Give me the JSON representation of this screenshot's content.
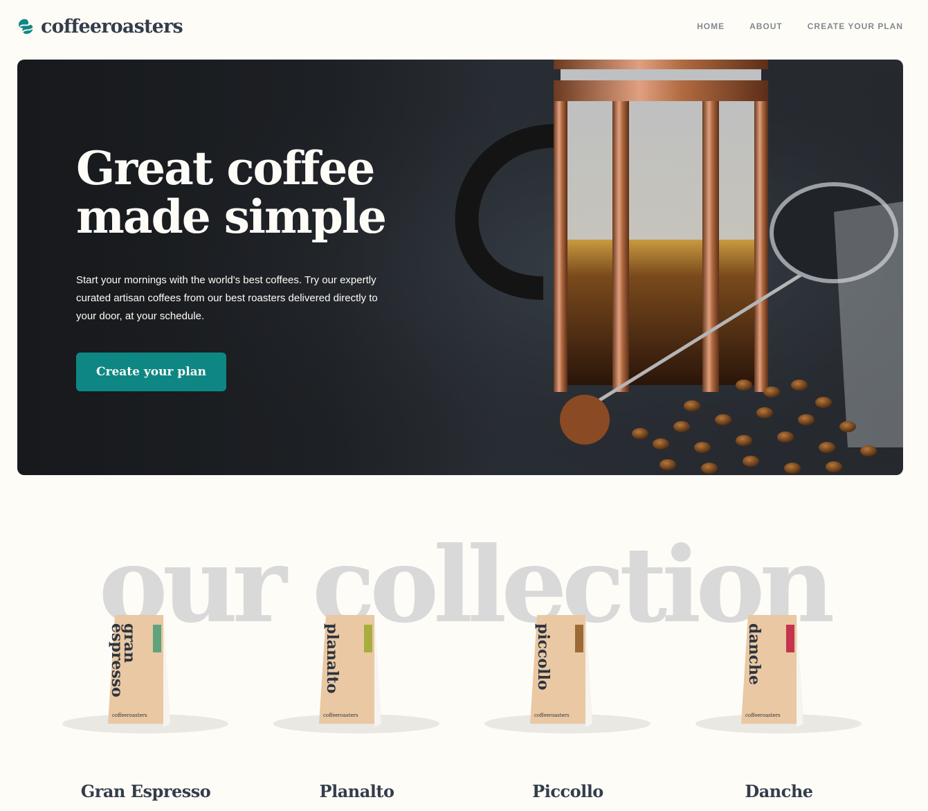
{
  "header": {
    "logo_text": "coffeeroasters",
    "nav": [
      {
        "label": "HOME"
      },
      {
        "label": "ABOUT"
      },
      {
        "label": "CREATE YOUR PLAN"
      }
    ]
  },
  "hero": {
    "title_line1": "Great coffee",
    "title_line2": "made simple",
    "text": "Start your mornings with the world's best coffees. Try our expertly curated artisan coffees from our best roasters delivered directly to your door, at your schedule.",
    "button_label": "Create your plan"
  },
  "collection": {
    "background_title": "our collection",
    "products": [
      {
        "name": "Gran Espresso",
        "bag_label_1": "gran",
        "bag_label_2": "espresso",
        "stripe_color": "#5fa27b",
        "brand": "coffeeroasters"
      },
      {
        "name": "Planalto",
        "bag_label_1": "planalto",
        "bag_label_2": "",
        "stripe_color": "#a9ad3d",
        "brand": "coffeeroasters"
      },
      {
        "name": "Piccollo",
        "bag_label_1": "piccollo",
        "bag_label_2": "",
        "stripe_color": "#9c6b35",
        "brand": "coffeeroasters"
      },
      {
        "name": "Danche",
        "bag_label_1": "danche",
        "bag_label_2": "",
        "stripe_color": "#c4344f",
        "brand": "coffeeroasters"
      }
    ]
  },
  "colors": {
    "accent": "#0e8784",
    "background": "#fefcf7",
    "text": "#333d4b",
    "nav": "#83888f"
  }
}
